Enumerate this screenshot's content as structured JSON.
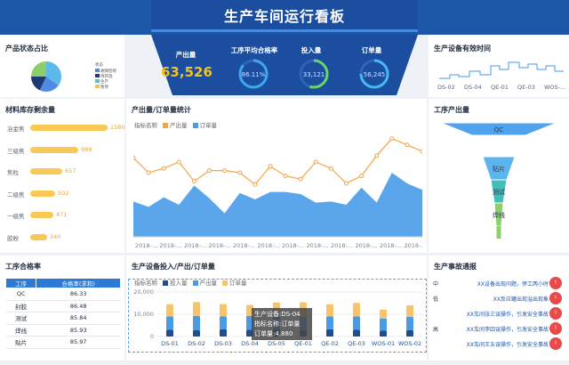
{
  "header": {
    "title": "生产车间运行看板"
  },
  "kpi": {
    "output_label": "产出量",
    "output_value": "63,526",
    "pass_rate_label": "工序平均合格率",
    "pass_rate_value": "86.11%",
    "pass_rate_fraction": 0.8611,
    "input_label": "投入量",
    "input_value": "33,121",
    "input_fraction": 0.55,
    "orders_label": "订单量",
    "orders_value": "56,245",
    "orders_fraction": 0.75
  },
  "product_status": {
    "title": "产品状态占比",
    "legend_title": "状态",
    "legend": [
      {
        "label": "故障检修",
        "color": "#4f8be3"
      },
      {
        "label": "待开放",
        "color": "#1f3a73"
      },
      {
        "label": "生产",
        "color": "#5fb8ea"
      },
      {
        "label": "暂停",
        "color": "#f2c34e"
      }
    ],
    "slices": [
      {
        "value": 35,
        "color": "#5fb8ea"
      },
      {
        "value": 22,
        "color": "#4f8be3"
      },
      {
        "value": 18,
        "color": "#1f3a73"
      },
      {
        "value": 25,
        "color": "#8bcf6a"
      }
    ]
  },
  "equipment_time": {
    "title": "生产设备有效时间",
    "x_labels": [
      "DS-02",
      "DS-04",
      "QE-01",
      "QE-03",
      "WOS-..."
    ]
  },
  "material": {
    "title": "材料库存剩余量",
    "max": 1600,
    "rows": [
      {
        "label": "冶金焦",
        "value": 1580
      },
      {
        "label": "三级焦",
        "value": 989
      },
      {
        "label": "焦粒",
        "value": 657
      },
      {
        "label": "二级焦",
        "value": 502
      },
      {
        "label": "一级焦",
        "value": 471
      },
      {
        "label": "胶粉",
        "value": 340
      }
    ]
  },
  "output_orders": {
    "title": "产出量/订单量统计",
    "legend_prefix": "指标名称",
    "legend": [
      {
        "label": "产出量",
        "color": "#f3a545"
      },
      {
        "label": "订单量",
        "color": "#4a9ae6"
      }
    ],
    "x_label": "2018-...",
    "output_line": [
      74,
      60,
      64,
      70,
      52,
      62,
      62,
      60,
      49,
      66,
      57,
      54,
      70,
      64,
      50,
      57,
      76,
      92,
      86,
      80
    ],
    "order_area": [
      33,
      28,
      37,
      30,
      48,
      36,
      22,
      41,
      35,
      42,
      42,
      40,
      32,
      33,
      30,
      46,
      32,
      60,
      50,
      44
    ],
    "ymax": 100
  },
  "process_output": {
    "title": "工序产出量",
    "stages": [
      {
        "label": "QC",
        "value": 100
      },
      {
        "label": "贴片",
        "value": 30
      },
      {
        "label": "测试",
        "value": 18
      },
      {
        "label": "焊线",
        "value": 10
      }
    ]
  },
  "process_pass": {
    "title": "工序合格率",
    "headers": [
      "工序",
      "合格率(求和)"
    ],
    "rows": [
      {
        "name": "QC",
        "rate": "86.33"
      },
      {
        "name": "封胶",
        "rate": "86.48"
      },
      {
        "name": "测试",
        "rate": "85.84"
      },
      {
        "name": "焊线",
        "rate": "85.93"
      },
      {
        "name": "贴片",
        "rate": "85.97"
      }
    ]
  },
  "equipment_io": {
    "title": "生产设备投入/产出/订单量",
    "legend_prefix": "指标名称",
    "legend": [
      {
        "label": "投入量",
        "color": "#1f4d8f"
      },
      {
        "label": "产出量",
        "color": "#4a9ae6"
      },
      {
        "label": "订单量",
        "color": "#f7c46b"
      }
    ],
    "y_ticks": [
      "20,000",
      "10,000",
      "0"
    ],
    "ymax": 20000,
    "categories": [
      "DS-01",
      "DS-02",
      "DS-03",
      "DS-04",
      "DS-05",
      "QE-01",
      "QE-02",
      "QE-03",
      "WOS-01",
      "WOS-02"
    ],
    "investment": [
      3000,
      2800,
      3200,
      3100,
      3000,
      2900,
      3300,
      3000,
      2600,
      2800
    ],
    "output": [
      6000,
      6500,
      5800,
      6200,
      6400,
      6000,
      5800,
      6100,
      5500,
      6000
    ],
    "orders": [
      5500,
      6200,
      5600,
      4880,
      5900,
      6500,
      5400,
      6000,
      4000,
      5200
    ],
    "tooltip": {
      "line1": "生产设备:DS-04",
      "line2": "指标名称:订单量",
      "line3": "订单量:4,880"
    }
  },
  "accidents": {
    "title": "生产事故通报",
    "items": [
      {
        "category": "中",
        "text": "XX设备出现问题，停工两小时",
        "badge": "!"
      },
      {
        "category": "低",
        "text": "XX反应罐出现溢出现象",
        "badge": "!"
      },
      {
        "category": "",
        "text": "XX车间张三误操作，引发安全事故",
        "badge": "!"
      },
      {
        "category": "高",
        "text": "XX车间李四误操作，引发安全事故",
        "badge": "!"
      },
      {
        "category": "",
        "text": "XX车间王五误操作，引发安全事故",
        "badge": "!"
      }
    ]
  }
}
